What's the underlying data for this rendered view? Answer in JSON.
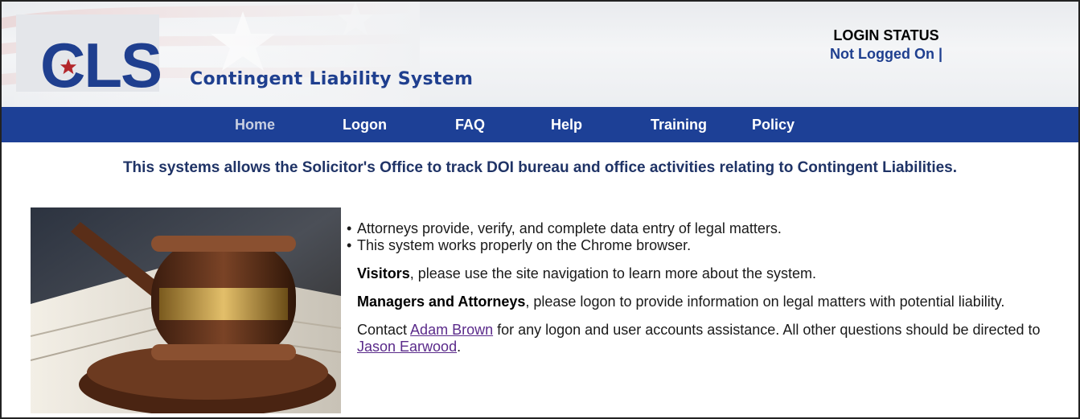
{
  "header": {
    "logo_text": "CLS",
    "site_title": "Contingent Liability System",
    "login_heading": "LOGIN STATUS",
    "login_value": "Not Logged On |"
  },
  "nav": {
    "items": [
      {
        "label": "Home",
        "active": true
      },
      {
        "label": "Logon",
        "active": false
      },
      {
        "label": "FAQ",
        "active": false
      },
      {
        "label": "Help",
        "active": false
      },
      {
        "label": "Training",
        "active": false
      },
      {
        "label": "Policy",
        "active": false
      }
    ]
  },
  "main": {
    "tagline": "This systems allows the Solicitor's Office to track DOI bureau and office activities relating to Contingent Liabilities.",
    "bullets": [
      "Attorneys provide, verify, and complete data entry of legal matters.",
      "This system works properly on the Chrome browser."
    ],
    "visitors_bold": "Visitors",
    "visitors_text": ", please use the site navigation to learn more about the system.",
    "managers_bold": "Managers and Attorneys",
    "managers_text": ", please logon to provide information on legal matters with potential liability.",
    "contact_prefix": "Contact ",
    "contact_link1": "Adam Brown",
    "contact_middle": " for any logon and user accounts assistance. All other questions should be directed to ",
    "contact_link2": "Jason Earwood",
    "contact_suffix": "."
  },
  "colors": {
    "brand_blue": "#1d4096",
    "link_purple": "#5a2a8a"
  }
}
